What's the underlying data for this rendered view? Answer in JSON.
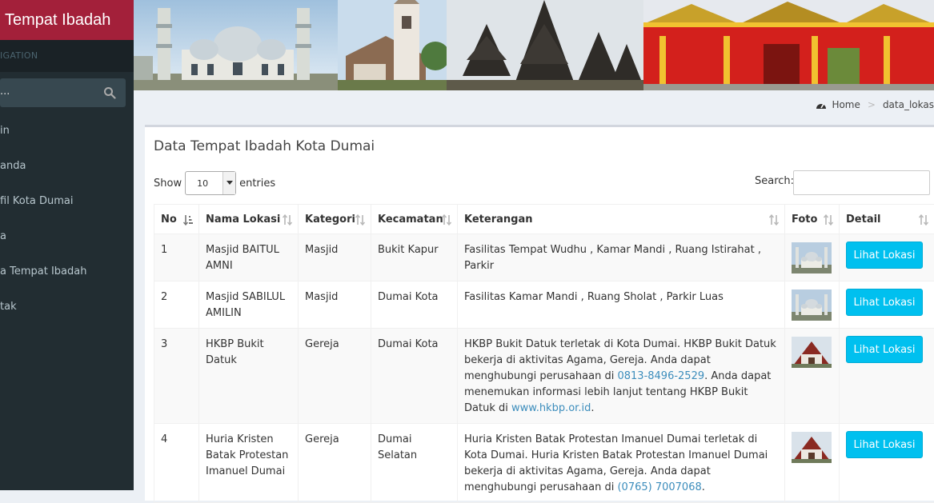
{
  "app": {
    "brand": "Tempat Ibadah",
    "nav_header": "IGATION",
    "search_placeholder": "..."
  },
  "sidebar": {
    "items": [
      {
        "label": "in"
      },
      {
        "label": "anda"
      },
      {
        "label": "fil Kota Dumai"
      },
      {
        "label": "a"
      },
      {
        "label": "a Tempat Ibadah"
      },
      {
        "label": "tak"
      }
    ]
  },
  "breadcrumb": {
    "home": "Home",
    "current": "data_lokas"
  },
  "box": {
    "title": "Data Tempat Ibadah Kota Dumai",
    "show_label": "Show",
    "entries_value": "10",
    "entries_label": "entries",
    "search_label": "Search:"
  },
  "table": {
    "headers": [
      "No",
      "Nama Lokasi",
      "Kategori",
      "Kecamatan",
      "Keterangan",
      "Foto",
      "Detail"
    ],
    "button_label": "Lihat Lokasi",
    "rows": [
      {
        "no": "1",
        "nama": "Masjid BAITUL AMNI",
        "kategori": "Masjid",
        "kecamatan": "Bukit Kapur",
        "ket_a": "Fasilitas Tempat Wudhu , Kamar Mandi , Ruang Istirahat , Parkir",
        "ket_link": "",
        "ket_b": "",
        "ket_link2": "",
        "ket_c": "",
        "foto": "mosque"
      },
      {
        "no": "2",
        "nama": "Masjid SABILUL AMILIN",
        "kategori": "Masjid",
        "kecamatan": "Dumai Kota",
        "ket_a": "Fasilitas Kamar Mandi , Ruang Sholat , Parkir Luas",
        "ket_link": "",
        "ket_b": "",
        "ket_link2": "",
        "ket_c": "",
        "foto": "mosque"
      },
      {
        "no": "3",
        "nama": "HKBP Bukit Datuk",
        "kategori": "Gereja",
        "kecamatan": "Dumai Kota",
        "ket_a": "HKBP Bukit Datuk terletak di Kota Dumai. HKBP Bukit Datuk bekerja di aktivitas Agama, Gereja. Anda dapat menghubungi perusahaan di ",
        "ket_link": "0813-8496-2529",
        "ket_b": ". Anda dapat menemukan informasi lebih lanjut tentang HKBP Bukit Datuk di ",
        "ket_link2": "www.hkbp.or.id",
        "ket_c": ".",
        "foto": "church"
      },
      {
        "no": "4",
        "nama": "Huria Kristen Batak Protestan Imanuel Dumai",
        "kategori": "Gereja",
        "kecamatan": "Dumai Selatan",
        "ket_a": "Huria Kristen Batak Protestan Imanuel Dumai terletak di Kota Dumai. Huria Kristen Batak Protestan Imanuel Dumai bekerja di aktivitas Agama, Gereja. Anda dapat menghubungi perusahaan di ",
        "ket_link": "(0765) 7007068",
        "ket_b": ".",
        "ket_link2": "",
        "ket_c": "",
        "foto": "church"
      }
    ]
  },
  "colors": {
    "brand_bg": "#a3203a",
    "sidebar_bg": "#222d32",
    "button_bg": "#00c0ef",
    "link": "#3c8dbc"
  }
}
